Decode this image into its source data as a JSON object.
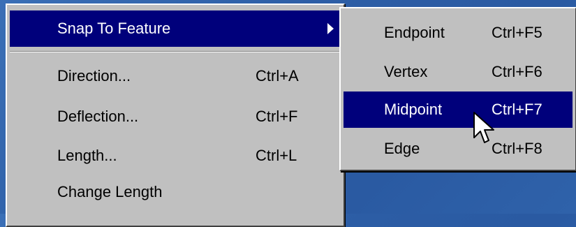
{
  "main_menu": {
    "items": [
      {
        "label": "Snap To Feature",
        "shortcut": ""
      },
      {
        "label": "Direction...",
        "shortcut": "Ctrl+A"
      },
      {
        "label": "Deflection...",
        "shortcut": "Ctrl+F"
      },
      {
        "label": "Length...",
        "shortcut": "Ctrl+L"
      },
      {
        "label": "Change Length",
        "shortcut": ""
      }
    ]
  },
  "sub_menu": {
    "items": [
      {
        "label": "Endpoint",
        "shortcut": "Ctrl+F5"
      },
      {
        "label": "Vertex",
        "shortcut": "Ctrl+F6"
      },
      {
        "label": "Midpoint",
        "shortcut": "Ctrl+F7"
      },
      {
        "label": "Edge",
        "shortcut": "Ctrl+F8"
      }
    ]
  },
  "colors": {
    "highlight": "#00007b",
    "menu_bg": "#c0c0c0",
    "desktop": "#2f62aa"
  },
  "icons": {
    "submenu_arrow": "triangle-right-icon",
    "cursor": "arrow-cursor-icon"
  }
}
